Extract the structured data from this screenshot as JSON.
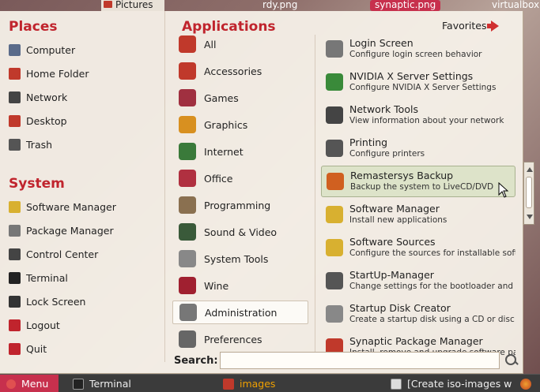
{
  "desktop": {
    "top_items": [
      "Pictures",
      "rdy.png",
      "synaptic.png",
      "virtualbox"
    ]
  },
  "places": {
    "title": "Places",
    "items": [
      {
        "label": "Computer",
        "icon": "computer-icon",
        "color": "#5a6b8a"
      },
      {
        "label": "Home Folder",
        "icon": "home-folder-icon",
        "color": "#c0392b"
      },
      {
        "label": "Network",
        "icon": "network-icon",
        "color": "#444444"
      },
      {
        "label": "Desktop",
        "icon": "desktop-icon",
        "color": "#c0392b"
      },
      {
        "label": "Trash",
        "icon": "trash-icon",
        "color": "#555555"
      }
    ]
  },
  "system": {
    "title": "System",
    "items": [
      {
        "label": "Software Manager",
        "icon": "software-manager-icon",
        "color": "#d8b030"
      },
      {
        "label": "Package Manager",
        "icon": "package-manager-icon",
        "color": "#777777"
      },
      {
        "label": "Control Center",
        "icon": "control-center-icon",
        "color": "#444444"
      },
      {
        "label": "Terminal",
        "icon": "terminal-icon",
        "color": "#222222"
      },
      {
        "label": "Lock Screen",
        "icon": "lock-screen-icon",
        "color": "#333333"
      },
      {
        "label": "Logout",
        "icon": "logout-icon",
        "color": "#c0242d"
      },
      {
        "label": "Quit",
        "icon": "quit-icon",
        "color": "#c0242d"
      }
    ]
  },
  "applications": {
    "title": "Applications",
    "favorites_label": "Favorites",
    "categories": [
      {
        "label": "All",
        "icon": "all-icon",
        "color": "#c0392b"
      },
      {
        "label": "Accessories",
        "icon": "accessories-icon",
        "color": "#c0392b"
      },
      {
        "label": "Games",
        "icon": "games-icon",
        "color": "#a03040"
      },
      {
        "label": "Graphics",
        "icon": "graphics-icon",
        "color": "#d89020"
      },
      {
        "label": "Internet",
        "icon": "internet-icon",
        "color": "#3a7a3a"
      },
      {
        "label": "Office",
        "icon": "office-icon",
        "color": "#b03040"
      },
      {
        "label": "Programming",
        "icon": "programming-icon",
        "color": "#8a7050"
      },
      {
        "label": "Sound & Video",
        "icon": "sound-video-icon",
        "color": "#3a5a3a"
      },
      {
        "label": "System Tools",
        "icon": "system-tools-icon",
        "color": "#888888"
      },
      {
        "label": "Wine",
        "icon": "wine-icon",
        "color": "#a02030"
      },
      {
        "label": "Administration",
        "icon": "administration-icon",
        "color": "#777777",
        "selected": true
      },
      {
        "label": "Preferences",
        "icon": "preferences-icon",
        "color": "#666666"
      }
    ],
    "apps": [
      {
        "name": "Login Screen",
        "desc": "Configure login screen behavior",
        "icon": "login-screen-icon",
        "color": "#777777"
      },
      {
        "name": "NVIDIA X Server Settings",
        "desc": "Configure NVIDIA X Server Settings",
        "icon": "nvidia-icon",
        "color": "#3a8a3a"
      },
      {
        "name": "Network Tools",
        "desc": "View information about your network",
        "icon": "network-tools-icon",
        "color": "#444444"
      },
      {
        "name": "Printing",
        "desc": "Configure printers",
        "icon": "printer-icon",
        "color": "#555555"
      },
      {
        "name": "Remastersys Backup",
        "desc": "Backup the system to LiveCD/DVD",
        "icon": "remastersys-icon",
        "color": "#d06020",
        "selected": true
      },
      {
        "name": "Software Manager",
        "desc": "Install new applications",
        "icon": "software-manager-icon",
        "color": "#d8b030"
      },
      {
        "name": "Software Sources",
        "desc": "Configure the sources for installable soft...",
        "icon": "software-sources-icon",
        "color": "#d8b030"
      },
      {
        "name": "StartUp-Manager",
        "desc": "Change settings for the bootloader and s...",
        "icon": "startup-manager-icon",
        "color": "#555555"
      },
      {
        "name": "Startup Disk Creator",
        "desc": "Create a startup disk using a CD or disc i...",
        "icon": "startup-disk-icon",
        "color": "#888888"
      },
      {
        "name": "Synaptic Package Manager",
        "desc": "Install, remove and upgrade software pa...",
        "icon": "synaptic-icon",
        "color": "#c0392b"
      }
    ]
  },
  "search": {
    "label": "Search:",
    "value": "",
    "placeholder": ""
  },
  "taskbar": {
    "menu_label": "Menu",
    "terminal_label": "Terminal",
    "images_label": "images",
    "iso_label": "[Create iso-images wit...",
    "accent": "#c7304d"
  }
}
